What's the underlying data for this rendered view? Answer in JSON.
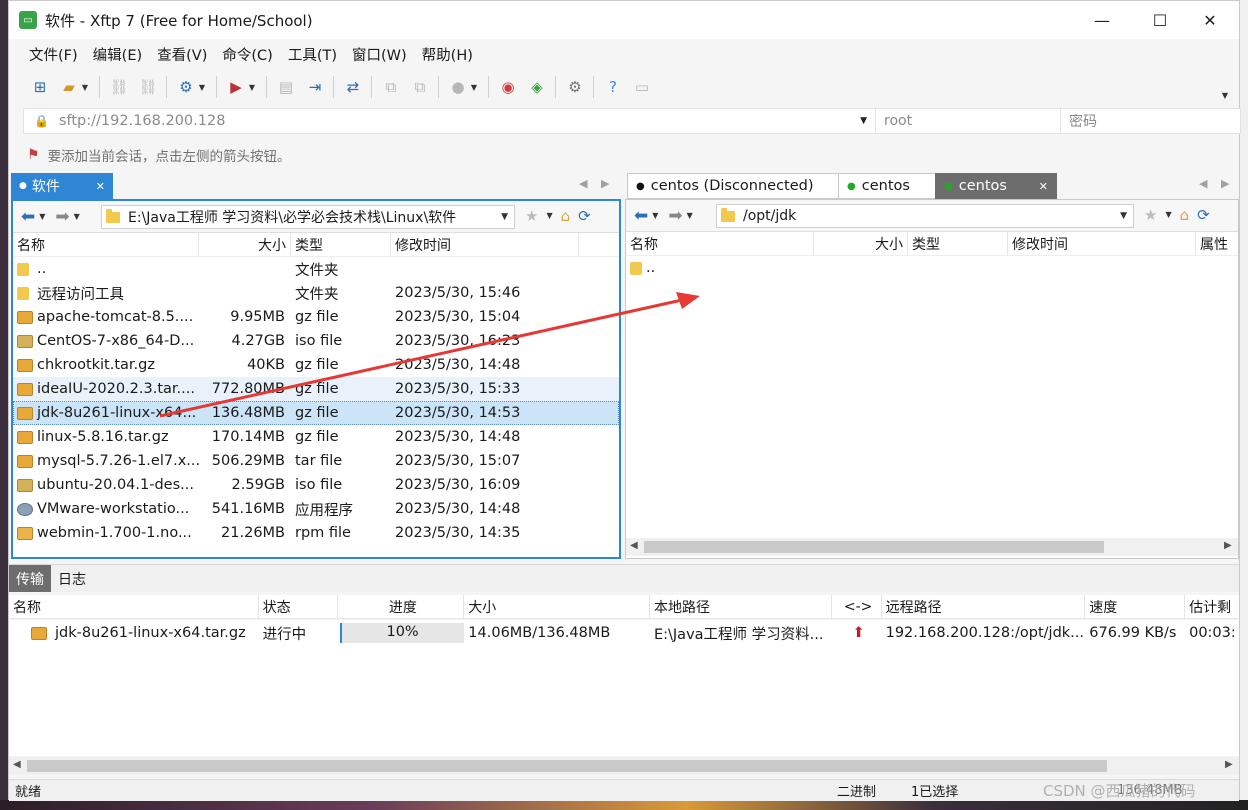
{
  "window": {
    "title": "软件 - Xftp 7 (Free for Home/School)",
    "app_icon": "xftp-icon"
  },
  "menu": [
    "文件(F)",
    "编辑(E)",
    "查看(V)",
    "命令(C)",
    "工具(T)",
    "窗口(W)",
    "帮助(H)"
  ],
  "address": {
    "url": "sftp://192.168.200.128",
    "user_placeholder": "root",
    "password_placeholder": "密码"
  },
  "hint": "要添加当前会话，点击左侧的箭头按钮。",
  "left": {
    "tab_label": "软件",
    "path": "E:\\Java工程师 学习资料\\必学必会技术栈\\Linux\\软件",
    "columns": [
      "名称",
      "大小",
      "类型",
      "修改时间"
    ],
    "rows": [
      {
        "name": "..",
        "size": "",
        "type": "文件夹",
        "modified": "",
        "icon": "dir"
      },
      {
        "name": "远程访问工具",
        "size": "",
        "type": "文件夹",
        "modified": "2023/5/30, 15:46",
        "icon": "dir"
      },
      {
        "name": "apache-tomcat-8.5....",
        "size": "9.95MB",
        "type": "gz file",
        "modified": "2023/5/30, 15:04",
        "icon": "gz"
      },
      {
        "name": "CentOS-7-x86_64-D...",
        "size": "4.27GB",
        "type": "iso file",
        "modified": "2023/5/30, 16:23",
        "icon": "iso"
      },
      {
        "name": "chkrootkit.tar.gz",
        "size": "40KB",
        "type": "gz file",
        "modified": "2023/5/30, 14:48",
        "icon": "gz"
      },
      {
        "name": "ideaIU-2020.2.3.tar....",
        "size": "772.80MB",
        "type": "gz file",
        "modified": "2023/5/30, 15:33",
        "icon": "gz",
        "state": "hover"
      },
      {
        "name": "jdk-8u261-linux-x64...",
        "size": "136.48MB",
        "type": "gz file",
        "modified": "2023/5/30, 14:53",
        "icon": "gz",
        "state": "selected"
      },
      {
        "name": "linux-5.8.16.tar.gz",
        "size": "170.14MB",
        "type": "gz file",
        "modified": "2023/5/30, 14:48",
        "icon": "gz"
      },
      {
        "name": "mysql-5.7.26-1.el7.x...",
        "size": "506.29MB",
        "type": "tar file",
        "modified": "2023/5/30, 15:07",
        "icon": "tar"
      },
      {
        "name": "ubuntu-20.04.1-des...",
        "size": "2.59GB",
        "type": "iso file",
        "modified": "2023/5/30, 16:09",
        "icon": "iso"
      },
      {
        "name": "VMware-workstatio...",
        "size": "541.16MB",
        "type": "应用程序",
        "modified": "2023/5/30, 14:48",
        "icon": "app"
      },
      {
        "name": "webmin-1.700-1.no...",
        "size": "21.26MB",
        "type": "rpm file",
        "modified": "2023/5/30, 14:35",
        "icon": "rpm"
      }
    ]
  },
  "right": {
    "tabs": [
      {
        "label": "centos (Disconnected)",
        "dot_color": "#111111"
      },
      {
        "label": "centos",
        "dot_color": "#22aa22"
      },
      {
        "label": "centos",
        "dot_color": "#22aa22",
        "active": true
      }
    ],
    "path": "/opt/jdk",
    "columns": [
      "名称",
      "大小",
      "类型",
      "修改时间",
      "属性"
    ],
    "rows": [
      {
        "name": "..",
        "icon": "dir"
      }
    ]
  },
  "transfer": {
    "tabs": [
      "传输",
      "日志"
    ],
    "columns": [
      "名称",
      "状态",
      "进度",
      "大小",
      "本地路径",
      "<->",
      "远程路径",
      "速度",
      "估计剩"
    ],
    "rows": [
      {
        "name": "jdk-8u261-linux-x64.tar.gz",
        "status": "进行中",
        "progress": 10,
        "progress_label": "10%",
        "size": "14.06MB/136.48MB",
        "local": "E:\\Java工程师 学习资料...",
        "direction": "upload-arrow-icon",
        "remote": "192.168.200.128:/opt/jdk...",
        "speed": "676.99 KB/s",
        "eta": "00:03:"
      }
    ]
  },
  "status": {
    "left": "就绪",
    "mode": "二进制",
    "selected": "1已选择",
    "size": "136.48MB",
    "watermark": "CSDN @西瓜猪的代码"
  },
  "colors": {
    "accent": "#2f86d4",
    "annotation_arrow": "#e53935"
  }
}
